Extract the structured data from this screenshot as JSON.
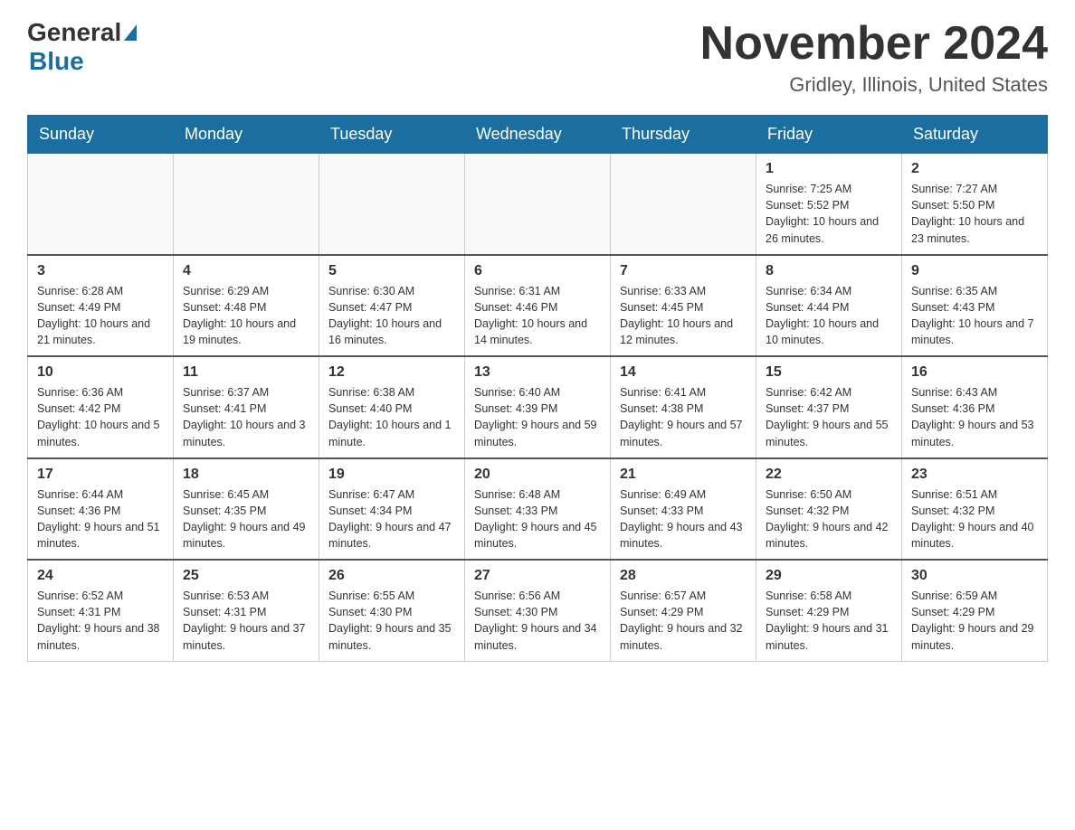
{
  "header": {
    "logo_general": "General",
    "logo_blue": "Blue",
    "month_title": "November 2024",
    "location": "Gridley, Illinois, United States"
  },
  "weekdays": [
    "Sunday",
    "Monday",
    "Tuesday",
    "Wednesday",
    "Thursday",
    "Friday",
    "Saturday"
  ],
  "weeks": [
    [
      {
        "day": "",
        "info": ""
      },
      {
        "day": "",
        "info": ""
      },
      {
        "day": "",
        "info": ""
      },
      {
        "day": "",
        "info": ""
      },
      {
        "day": "",
        "info": ""
      },
      {
        "day": "1",
        "info": "Sunrise: 7:25 AM\nSunset: 5:52 PM\nDaylight: 10 hours and 26 minutes."
      },
      {
        "day": "2",
        "info": "Sunrise: 7:27 AM\nSunset: 5:50 PM\nDaylight: 10 hours and 23 minutes."
      }
    ],
    [
      {
        "day": "3",
        "info": "Sunrise: 6:28 AM\nSunset: 4:49 PM\nDaylight: 10 hours and 21 minutes."
      },
      {
        "day": "4",
        "info": "Sunrise: 6:29 AM\nSunset: 4:48 PM\nDaylight: 10 hours and 19 minutes."
      },
      {
        "day": "5",
        "info": "Sunrise: 6:30 AM\nSunset: 4:47 PM\nDaylight: 10 hours and 16 minutes."
      },
      {
        "day": "6",
        "info": "Sunrise: 6:31 AM\nSunset: 4:46 PM\nDaylight: 10 hours and 14 minutes."
      },
      {
        "day": "7",
        "info": "Sunrise: 6:33 AM\nSunset: 4:45 PM\nDaylight: 10 hours and 12 minutes."
      },
      {
        "day": "8",
        "info": "Sunrise: 6:34 AM\nSunset: 4:44 PM\nDaylight: 10 hours and 10 minutes."
      },
      {
        "day": "9",
        "info": "Sunrise: 6:35 AM\nSunset: 4:43 PM\nDaylight: 10 hours and 7 minutes."
      }
    ],
    [
      {
        "day": "10",
        "info": "Sunrise: 6:36 AM\nSunset: 4:42 PM\nDaylight: 10 hours and 5 minutes."
      },
      {
        "day": "11",
        "info": "Sunrise: 6:37 AM\nSunset: 4:41 PM\nDaylight: 10 hours and 3 minutes."
      },
      {
        "day": "12",
        "info": "Sunrise: 6:38 AM\nSunset: 4:40 PM\nDaylight: 10 hours and 1 minute."
      },
      {
        "day": "13",
        "info": "Sunrise: 6:40 AM\nSunset: 4:39 PM\nDaylight: 9 hours and 59 minutes."
      },
      {
        "day": "14",
        "info": "Sunrise: 6:41 AM\nSunset: 4:38 PM\nDaylight: 9 hours and 57 minutes."
      },
      {
        "day": "15",
        "info": "Sunrise: 6:42 AM\nSunset: 4:37 PM\nDaylight: 9 hours and 55 minutes."
      },
      {
        "day": "16",
        "info": "Sunrise: 6:43 AM\nSunset: 4:36 PM\nDaylight: 9 hours and 53 minutes."
      }
    ],
    [
      {
        "day": "17",
        "info": "Sunrise: 6:44 AM\nSunset: 4:36 PM\nDaylight: 9 hours and 51 minutes."
      },
      {
        "day": "18",
        "info": "Sunrise: 6:45 AM\nSunset: 4:35 PM\nDaylight: 9 hours and 49 minutes."
      },
      {
        "day": "19",
        "info": "Sunrise: 6:47 AM\nSunset: 4:34 PM\nDaylight: 9 hours and 47 minutes."
      },
      {
        "day": "20",
        "info": "Sunrise: 6:48 AM\nSunset: 4:33 PM\nDaylight: 9 hours and 45 minutes."
      },
      {
        "day": "21",
        "info": "Sunrise: 6:49 AM\nSunset: 4:33 PM\nDaylight: 9 hours and 43 minutes."
      },
      {
        "day": "22",
        "info": "Sunrise: 6:50 AM\nSunset: 4:32 PM\nDaylight: 9 hours and 42 minutes."
      },
      {
        "day": "23",
        "info": "Sunrise: 6:51 AM\nSunset: 4:32 PM\nDaylight: 9 hours and 40 minutes."
      }
    ],
    [
      {
        "day": "24",
        "info": "Sunrise: 6:52 AM\nSunset: 4:31 PM\nDaylight: 9 hours and 38 minutes."
      },
      {
        "day": "25",
        "info": "Sunrise: 6:53 AM\nSunset: 4:31 PM\nDaylight: 9 hours and 37 minutes."
      },
      {
        "day": "26",
        "info": "Sunrise: 6:55 AM\nSunset: 4:30 PM\nDaylight: 9 hours and 35 minutes."
      },
      {
        "day": "27",
        "info": "Sunrise: 6:56 AM\nSunset: 4:30 PM\nDaylight: 9 hours and 34 minutes."
      },
      {
        "day": "28",
        "info": "Sunrise: 6:57 AM\nSunset: 4:29 PM\nDaylight: 9 hours and 32 minutes."
      },
      {
        "day": "29",
        "info": "Sunrise: 6:58 AM\nSunset: 4:29 PM\nDaylight: 9 hours and 31 minutes."
      },
      {
        "day": "30",
        "info": "Sunrise: 6:59 AM\nSunset: 4:29 PM\nDaylight: 9 hours and 29 minutes."
      }
    ]
  ]
}
